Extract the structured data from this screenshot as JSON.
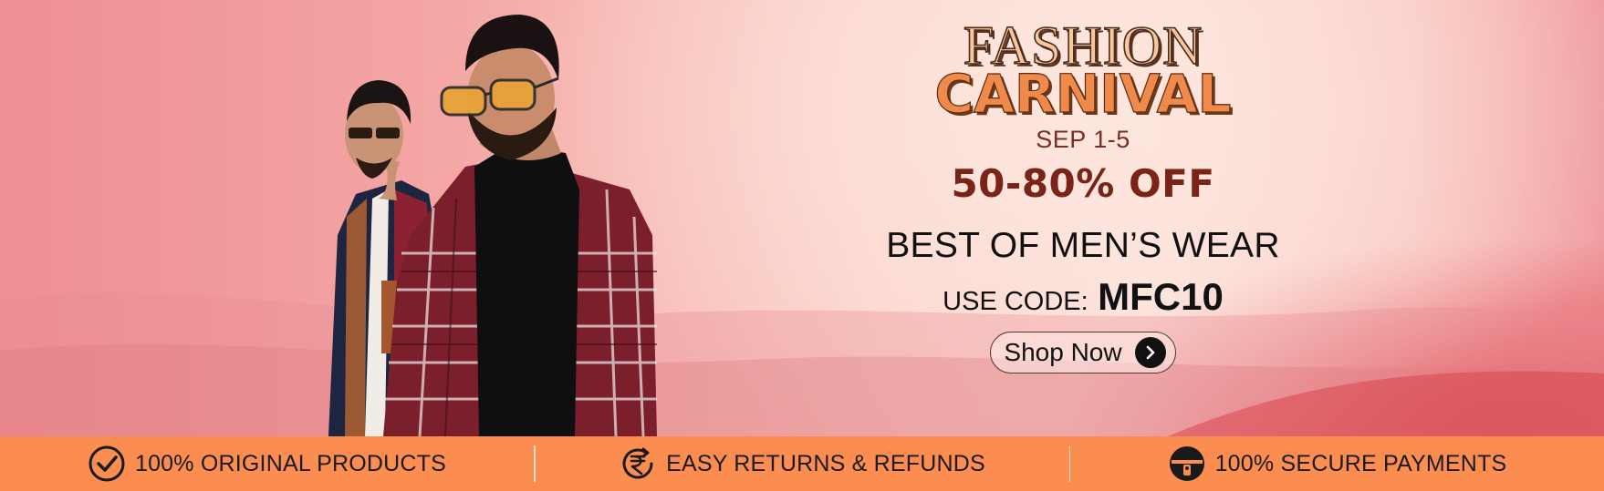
{
  "banner": {
    "title_line1": "FASHION",
    "title_line2": "CARNIVAL",
    "dates": "SEP 1-5",
    "discount": "50-80% OFF",
    "headline": "BEST OF MEN’S WEAR",
    "code_label": "USE CODE:",
    "code_value": "MFC10",
    "shop_button": "Shop Now",
    "shop_icon": "chevron-right-icon"
  },
  "features": [
    {
      "icon": "checkmark-circle-icon",
      "label": "100% ORIGINAL PRODUCTS"
    },
    {
      "icon": "rupee-return-icon",
      "label": "EASY RETURNS & REFUNDS"
    },
    {
      "icon": "lock-icon",
      "label": "100% SECURE PAYMENTS"
    }
  ],
  "colors": {
    "strip": "#fb8d50",
    "discount": "#7a2317",
    "title_accent": "#f08a4b"
  }
}
